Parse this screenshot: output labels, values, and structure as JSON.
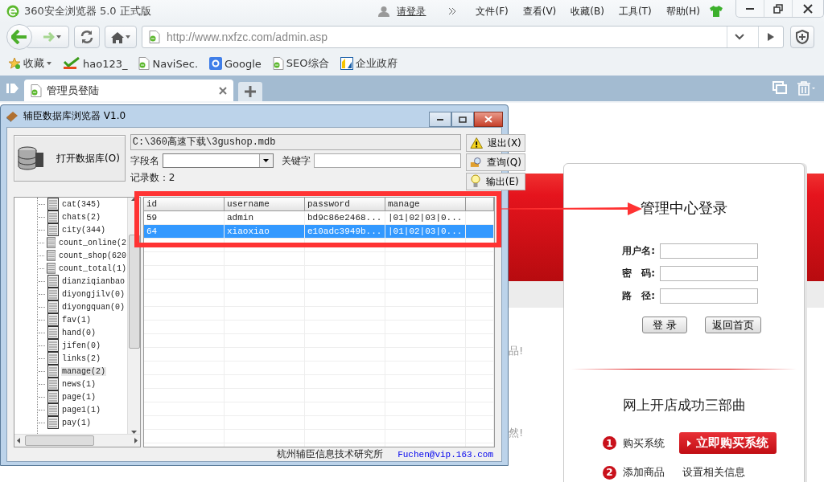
{
  "browser": {
    "title": "360安全浏览器 5.0 正式版",
    "login_link": "请登录",
    "menu": [
      "文件(F)",
      "查看(V)",
      "收藏(B)",
      "工具(T)",
      "帮助(H)"
    ],
    "address": "http://www.nxfzc.com/admin.asp",
    "bookmarks": [
      {
        "kind": "star",
        "label": "收藏"
      },
      {
        "kind": "hao",
        "label": "hao123_"
      },
      {
        "kind": "page",
        "label": "NaviSec."
      },
      {
        "kind": "google",
        "label": "Google"
      },
      {
        "kind": "page",
        "label": "SEO综合"
      },
      {
        "kind": "gov",
        "label": "企业政府"
      }
    ],
    "tabs": [
      {
        "label": "管理员登陆",
        "selected": true
      }
    ]
  },
  "page": {
    "fragments": [
      "品!",
      "然!"
    ],
    "login": {
      "title": "管理中心登录",
      "fields": [
        {
          "label": "用户名:"
        },
        {
          "label": "密　码:"
        },
        {
          "label": "路　径:"
        }
      ],
      "buttons": [
        "登 录",
        "返回首页"
      ],
      "steps_title": "网上开店成功三部曲",
      "steps": [
        {
          "number": "1",
          "text": "购买系统",
          "action": "立即购买系统"
        },
        {
          "number": "2",
          "text": "添加商品",
          "note": "设置相关信息"
        }
      ]
    }
  },
  "dialog": {
    "title": "辅臣数据库浏览器 V1.0",
    "open_button": "打开数据库(O)",
    "path": "C:\\360高速下载\\3gushop.mdb",
    "field_label": "字段名",
    "keyword_label": "关键字",
    "record_count": "记录数：2",
    "actions": [
      {
        "kind": "warning",
        "label": "退出(X)"
      },
      {
        "kind": "search",
        "label": "查询(Q)"
      },
      {
        "kind": "bulb",
        "label": "输出(E)"
      }
    ],
    "tables": [
      {
        "label": "cat(345)",
        "selected": false
      },
      {
        "label": "chats(2)",
        "selected": false
      },
      {
        "label": "city(344)",
        "selected": false
      },
      {
        "label": "count_online(2",
        "selected": false
      },
      {
        "label": "count_shop(620",
        "selected": false
      },
      {
        "label": "count_total(1)",
        "selected": false
      },
      {
        "label": "dianziqianbao",
        "selected": false
      },
      {
        "label": "diyongjilv(0)",
        "selected": false
      },
      {
        "label": "diyongquan(0)",
        "selected": false
      },
      {
        "label": "fav(1)",
        "selected": false
      },
      {
        "label": "hand(0)",
        "selected": false
      },
      {
        "label": "jifen(0)",
        "selected": false
      },
      {
        "label": "links(2)",
        "selected": false
      },
      {
        "label": "manage(2)",
        "selected": true
      },
      {
        "label": "news(1)",
        "selected": false
      },
      {
        "label": "page(1)",
        "selected": false
      },
      {
        "label": "page1(1)",
        "selected": false
      },
      {
        "label": "pay(1)",
        "selected": false
      }
    ],
    "columns": [
      "id",
      "username",
      "password",
      "manage"
    ],
    "rows": [
      {
        "cells": [
          "59",
          "admin",
          "bd9c86e2468...",
          "|01|02|03|0..."
        ],
        "selected": false
      },
      {
        "cells": [
          "64",
          "xiaoxiao",
          "e10adc3949b...",
          "|01|02|03|0..."
        ],
        "selected": true
      }
    ],
    "footer_text": "杭州辅臣信息技术研究所",
    "footer_email": "Fuchen@vip.163.com"
  }
}
